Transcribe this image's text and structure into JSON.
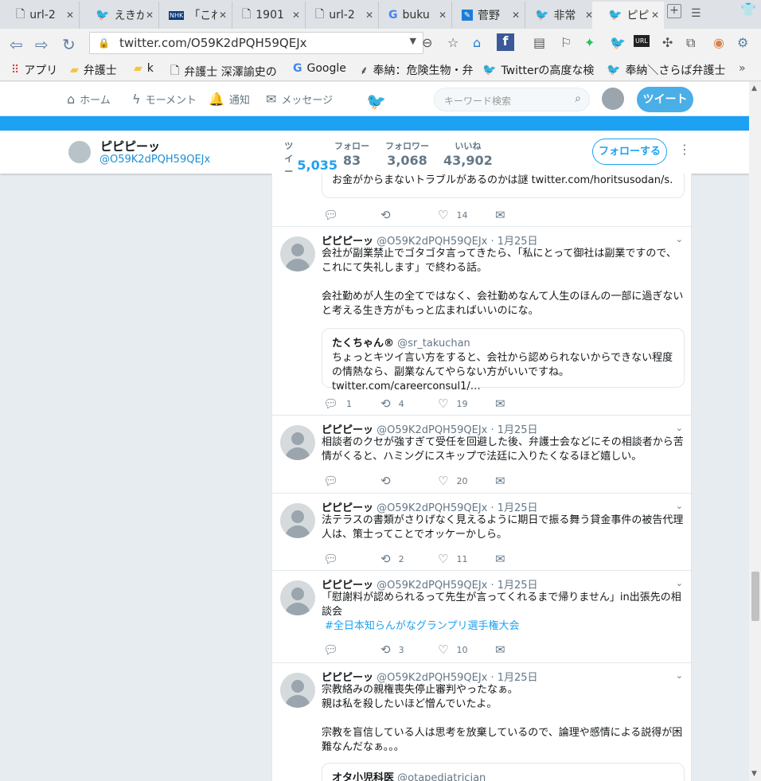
{
  "browser": {
    "tabs": [
      {
        "title": "url-2",
        "icon": "page-icon"
      },
      {
        "title": "えきが",
        "icon": "twitter-icon"
      },
      {
        "title": "「これ",
        "icon": "nhk-icon"
      },
      {
        "title": "1901",
        "icon": "page-icon"
      },
      {
        "title": "url-2",
        "icon": "page-icon"
      },
      {
        "title": "buku",
        "icon": "google-icon"
      },
      {
        "title": "菅野",
        "icon": "link-icon"
      },
      {
        "title": "非常",
        "icon": "twitter-icon"
      },
      {
        "title": "ピピピ",
        "icon": "twitter-icon"
      }
    ],
    "url": "twitter.com/O59K2dPQH59QEJx",
    "bookmarks": [
      {
        "label": "アプリ",
        "icon": "apps-icon"
      },
      {
        "label": "弁護士",
        "icon": "folder-icon"
      },
      {
        "label": "k",
        "icon": "folder-icon"
      },
      {
        "label": "弁護士 深澤諭史の",
        "icon": "page-icon"
      },
      {
        "label": "Google",
        "icon": "google-icon"
      },
      {
        "label": "奉納：危険生物・弁",
        "icon": "tree-icon"
      },
      {
        "label": "Twitterの高度な検",
        "icon": "twitter-icon"
      },
      {
        "label": "奉納＼さらば弁護士",
        "icon": "twitter-icon"
      }
    ]
  },
  "twitter": {
    "nav": {
      "home": "ホーム",
      "moments": "モーメント",
      "notifications": "通知",
      "messages": "メッセージ"
    },
    "search_placeholder": "キーワード検索",
    "tweet_button": "ツイート"
  },
  "profile": {
    "name": "ピピピーッ",
    "handle": "@O59K2dPQH59QEJx",
    "stats": [
      {
        "label": "ツイート",
        "value": "5,035"
      },
      {
        "label": "フォロー",
        "value": "83"
      },
      {
        "label": "フォロワー",
        "value": "3,068"
      },
      {
        "label": "いいね",
        "value": "43,902"
      }
    ],
    "follow_button": "フォローする"
  },
  "timeline": {
    "top_partial": {
      "quote_text": "お金がからまないトラブルがあるのかは謎 twitter.com/horitsusodan/s…",
      "likes": "14"
    },
    "tweets": [
      {
        "name": "ピピピーッ",
        "handle": "@O59K2dPQH59QEJx",
        "time": "· 1月25日",
        "text": "会社が副業禁止でゴタゴタ言ってきたら、「私にとって御社は副業ですので、これにて失礼します」で終わる話。\n\n会社勤めが人生の全てではなく、会社勤めなんて人生のほんの一部に過ぎないと考える生き方がもっと広まればいいのにな。",
        "quote": {
          "name": "たくちゃん®",
          "handle": "@sr_takuchan",
          "text": "ちょっとキツイ言い方をすると、会社から認められないからできない程度の情熱なら、副業なんてやらない方がいいですね。twitter.com/careerconsul1/…"
        },
        "replies": "1",
        "retweets": "4",
        "likes": "19"
      },
      {
        "name": "ピピピーッ",
        "handle": "@O59K2dPQH59QEJx",
        "time": "· 1月25日",
        "text": "相談者のクセが強すぎて受任を回避した後、弁護士会などにその相談者から苦情がくると、ハミングにスキップで法廷に入りたくなるほど嬉しい。",
        "replies": "",
        "retweets": "",
        "likes": "20"
      },
      {
        "name": "ピピピーッ",
        "handle": "@O59K2dPQH59QEJx",
        "time": "· 1月25日",
        "text": "法テラスの書類がさりげなく見えるように期日で振る舞う貸金事件の被告代理人は、策士ってことでオッケーかしら。",
        "replies": "",
        "retweets": "2",
        "likes": "11"
      },
      {
        "name": "ピピピーッ",
        "handle": "@O59K2dPQH59QEJx",
        "time": "· 1月25日",
        "text": "「慰謝料が認められるって先生が言ってくれるまで帰りません」in出張先の相談会",
        "hashtag": "#全日本知らんがなグランプリ選手権大会",
        "replies": "",
        "retweets": "3",
        "likes": "10"
      },
      {
        "name": "ピピピーッ",
        "handle": "@O59K2dPQH59QEJx",
        "time": "· 1月25日",
        "text": "宗教絡みの親権喪失停止審判やったなぁ。\n親は私を殺したいほど憎んでいたよ。\n\n宗教を盲信している人は思考を放棄しているので、論理や感情による説得が困難なんだなぁ。。。",
        "quote": {
          "name": "オタ小児科医",
          "handle": "@otapediatrician",
          "text": ""
        }
      }
    ]
  }
}
